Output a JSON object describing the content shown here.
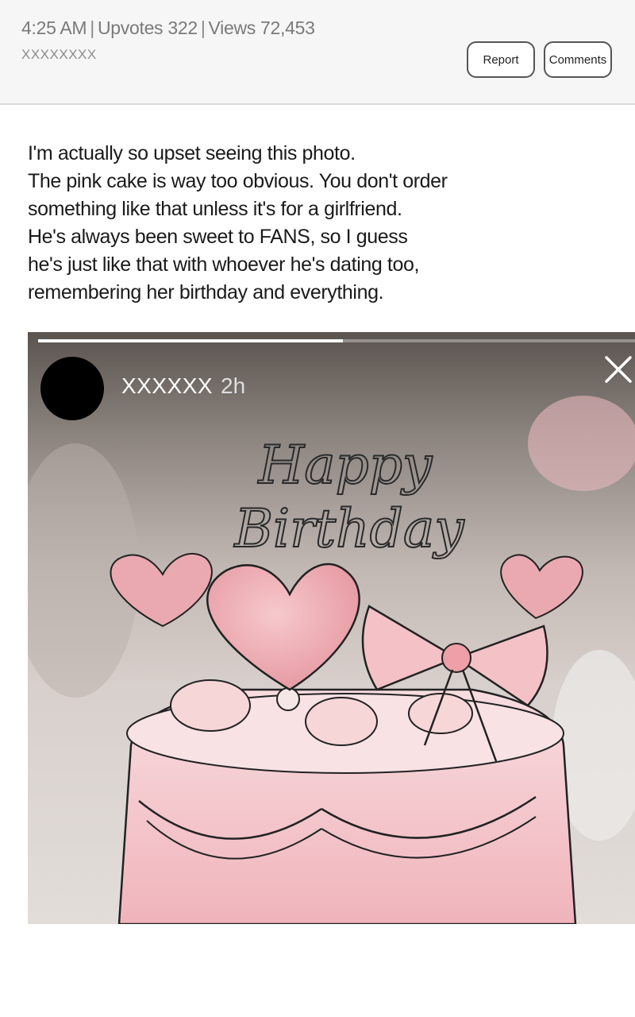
{
  "header": {
    "time": "4:25 AM",
    "upvotes": "Upvotes 322",
    "views": "Views 72,453",
    "author": "XXXXXXXX",
    "report_label": "Report",
    "comments_label": "Comments"
  },
  "post": {
    "lines": [
      "I'm actually so upset seeing this photo.",
      "The pink cake is way too obvious. You don't order",
      "something like that unless it's for a girlfriend.",
      "He's always been sweet to FANS, so I guess",
      "he's just like that with whoever he's dating too,",
      "remembering her birthday and everything."
    ]
  },
  "story": {
    "username": "XXXXXX",
    "time_ago": "2h",
    "progress": 0.51,
    "topper_line1": "Happy",
    "topper_line2": "Birthday",
    "colors": {
      "cake_pink": "#f2b9bf",
      "cake_light": "#f7d6d8",
      "bow": "#f4c1c6"
    }
  }
}
